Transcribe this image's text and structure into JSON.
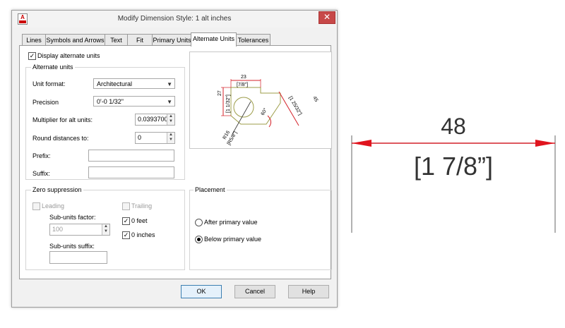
{
  "dialog": {
    "title": "Modify Dimension Style: 1 alt inches",
    "app_icon": "A",
    "close": "✕"
  },
  "tabs": [
    {
      "label": "Lines"
    },
    {
      "label": "Symbols and Arrows"
    },
    {
      "label": "Text"
    },
    {
      "label": "Fit"
    },
    {
      "label": "Primary Units"
    },
    {
      "label": "Alternate Units",
      "active": true
    },
    {
      "label": "Tolerances"
    }
  ],
  "display_alt": {
    "label": "Display alternate units",
    "checked": true
  },
  "alt_units": {
    "group_label": "Alternate units",
    "unit_format_label": "Unit format:",
    "unit_format_value": "Architectural",
    "precision_label": "Precision",
    "precision_value": "0'-0 1/32\"",
    "multiplier_label": "Multiplier for alt units:",
    "multiplier_value": "0.0393700",
    "round_label": "Round distances  to:",
    "round_value": "0",
    "prefix_label": "Prefix:",
    "prefix_value": "",
    "suffix_label": "Suffix:",
    "suffix_value": ""
  },
  "zero_suppression": {
    "group_label": "Zero suppression",
    "leading_label": "Leading",
    "leading_checked": false,
    "trailing_label": "Trailing",
    "trailing_checked": false,
    "subunits_factor_label": "Sub-units factor:",
    "subunits_factor_value": "100",
    "feet_label": "0 feet",
    "feet_checked": true,
    "inches_label": "0 inches",
    "inches_checked": true,
    "subunits_suffix_label": "Sub-units suffix:",
    "subunits_suffix_value": ""
  },
  "placement": {
    "group_label": "Placement",
    "after_label": "After primary value",
    "below_label": "Below primary value",
    "selected": "below"
  },
  "preview": {
    "dim_27": "27",
    "alt_27": "[1 1/32\"]",
    "dim_23": "23",
    "alt_23": "[7/8\"]",
    "dim_45": "45",
    "alt_45": "[1 25/32\"]",
    "angle": "60°",
    "radius": "R16",
    "alt_radius": "[R5/8\"]"
  },
  "buttons": {
    "ok": "OK",
    "cancel": "Cancel",
    "help": "Help"
  },
  "example": {
    "primary": "48",
    "alternate": "[1  7/8”]"
  },
  "colors": {
    "arrow": "#e0141e",
    "dim_line": "#d42028",
    "preview_part": "#9d9d4a"
  }
}
